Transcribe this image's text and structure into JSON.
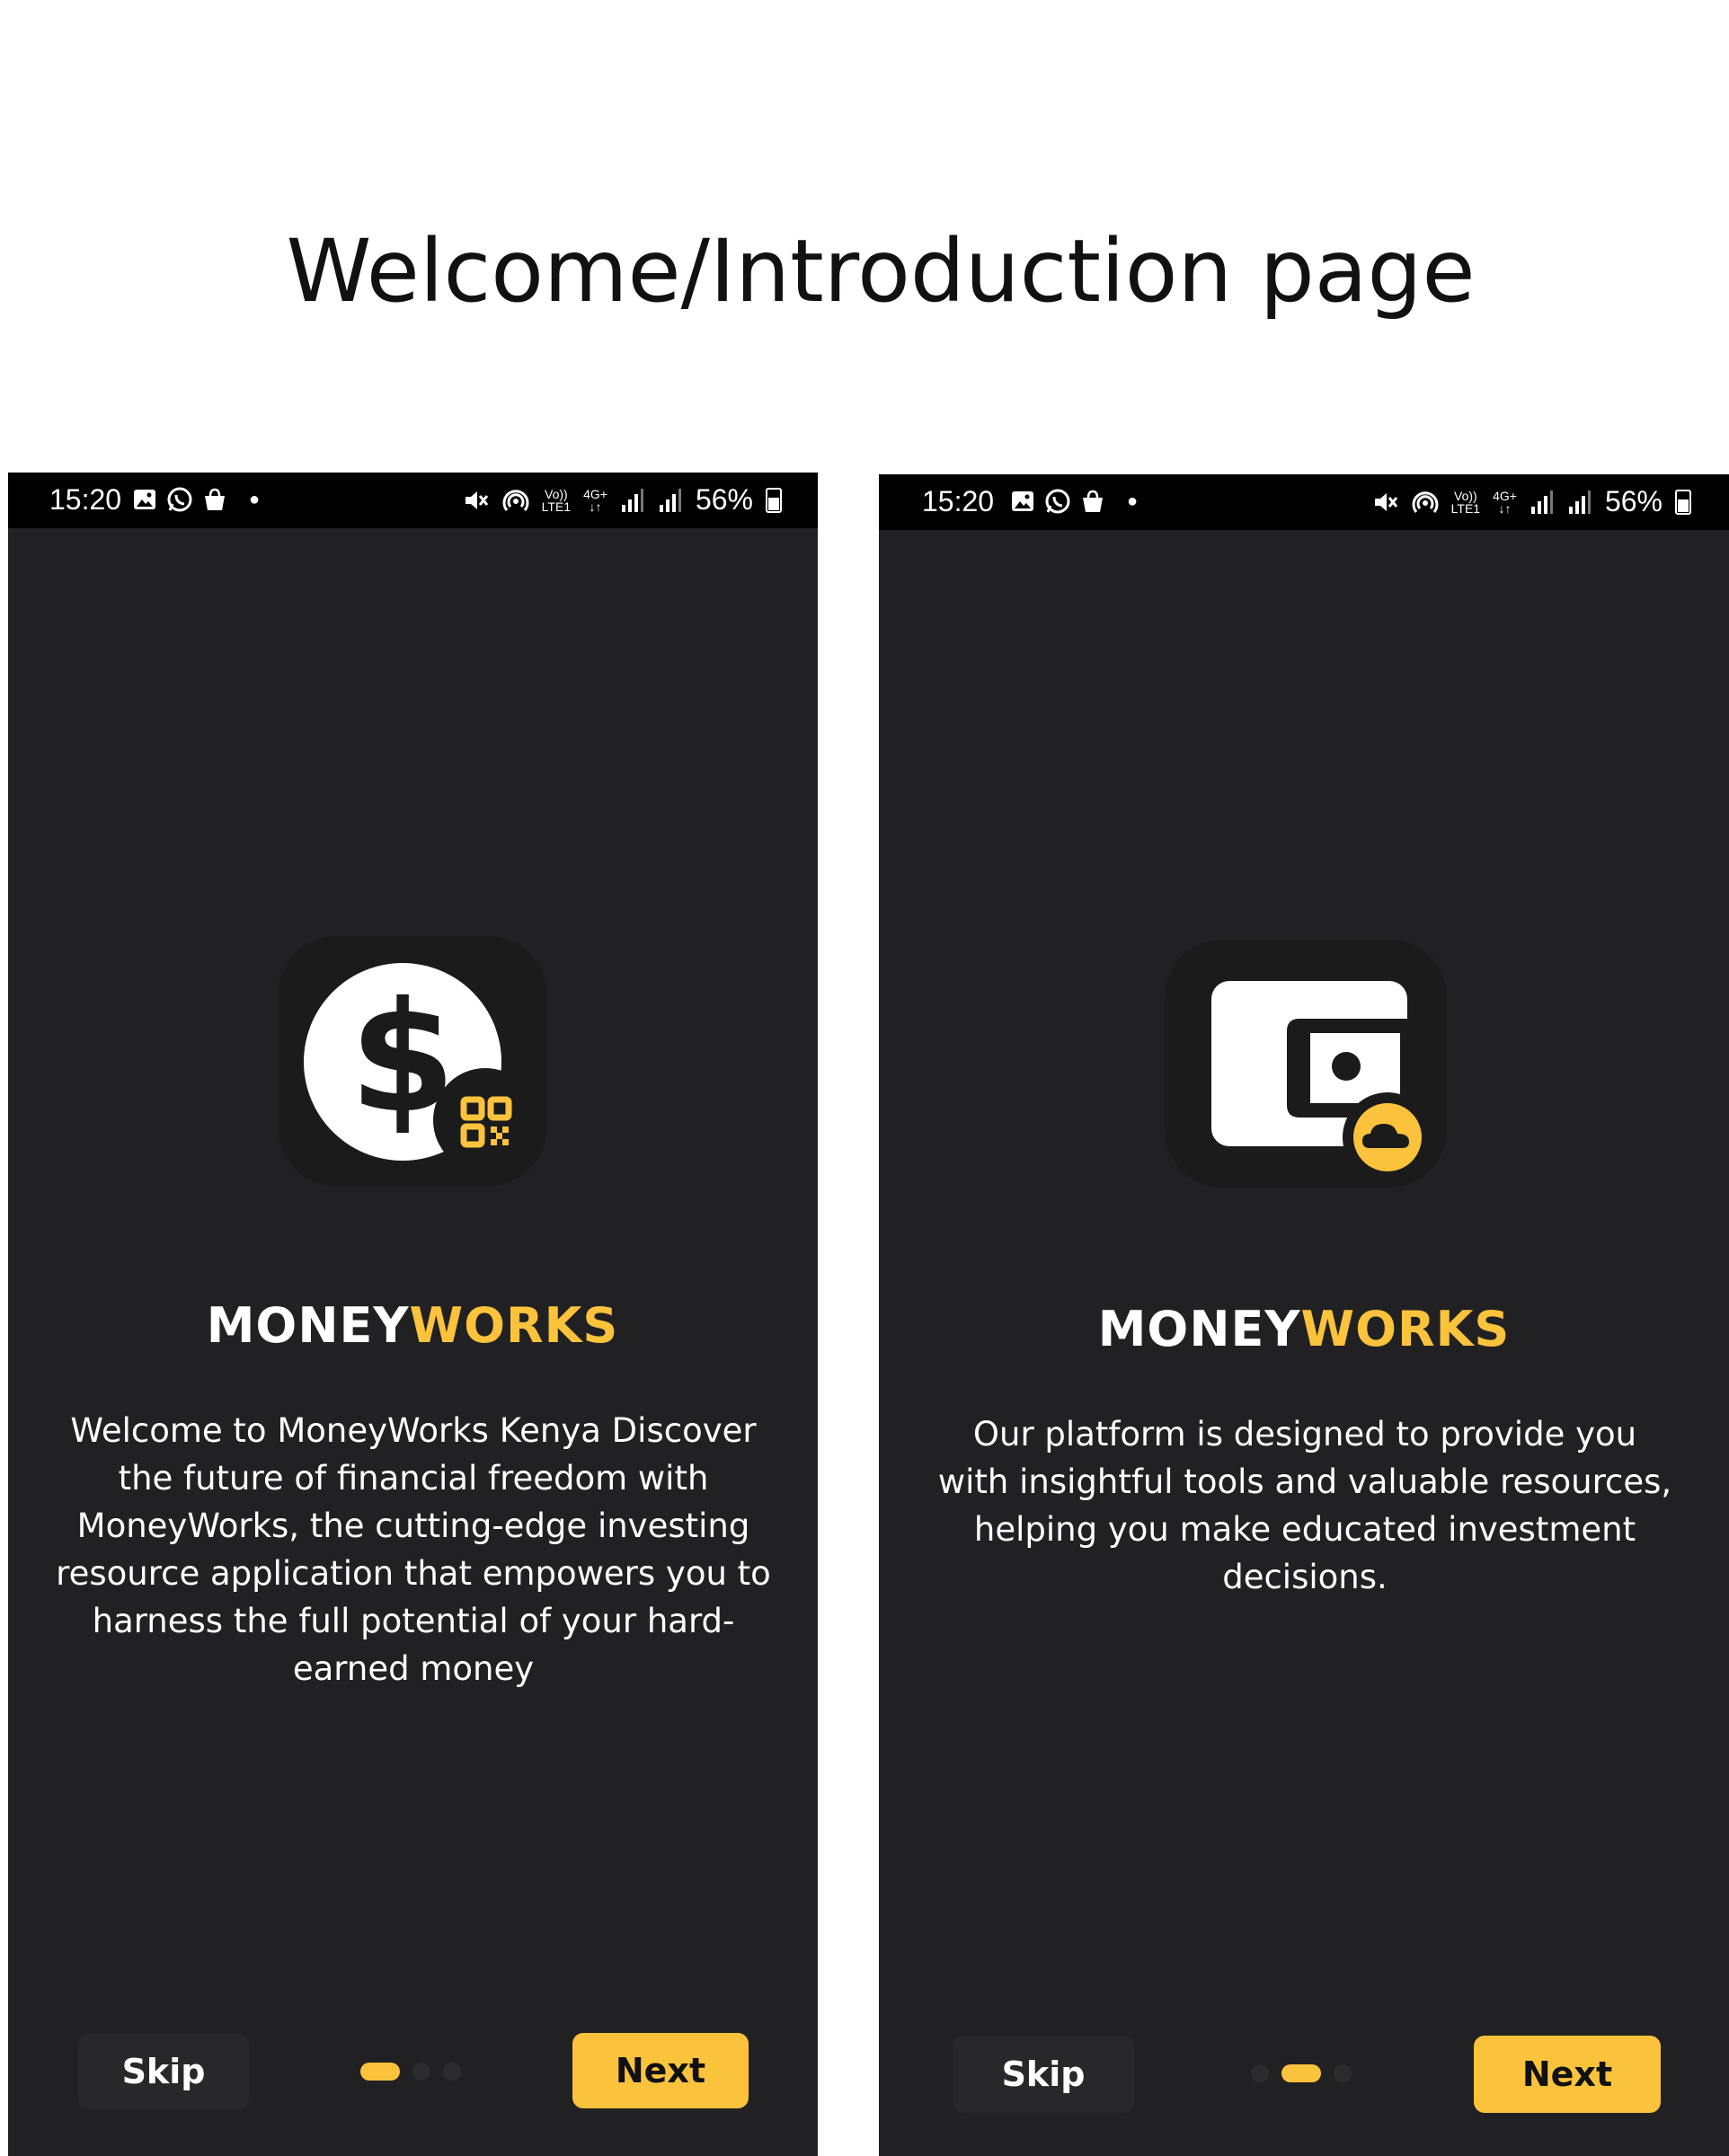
{
  "page_title": "Welcome/Introduction page",
  "colors": {
    "accent": "#fbc23c",
    "screen_bg": "#212123",
    "status_bg": "#000000"
  },
  "screens": [
    {
      "status": {
        "time": "15:20",
        "battery": "56%",
        "net_top": "Vo))",
        "net_bottom": "LTE1",
        "net_type": "4G+"
      },
      "brand": {
        "part1": "MONEY",
        "part2": "WORKS"
      },
      "icon": "dollar-qr-icon",
      "description": "Welcome to MoneyWorks Kenya  Discover the future of financial freedom with MoneyWorks, the cutting-edge investing resource application that empowers you to harness the full potential of your hard-earned money",
      "skip_label": "Skip",
      "next_label": "Next",
      "active_dot": 0
    },
    {
      "status": {
        "time": "15:20",
        "battery": "56%",
        "net_top": "Vo))",
        "net_bottom": "LTE1",
        "net_type": "4G+"
      },
      "brand": {
        "part1": "MONEY",
        "part2": "WORKS"
      },
      "icon": "wallet-cloud-icon",
      "description": "Our platform is designed to provide you with insightful tools and valuable resources, helping you make educated investment decisions.",
      "skip_label": "Skip",
      "next_label": "Next",
      "active_dot": 1
    }
  ]
}
